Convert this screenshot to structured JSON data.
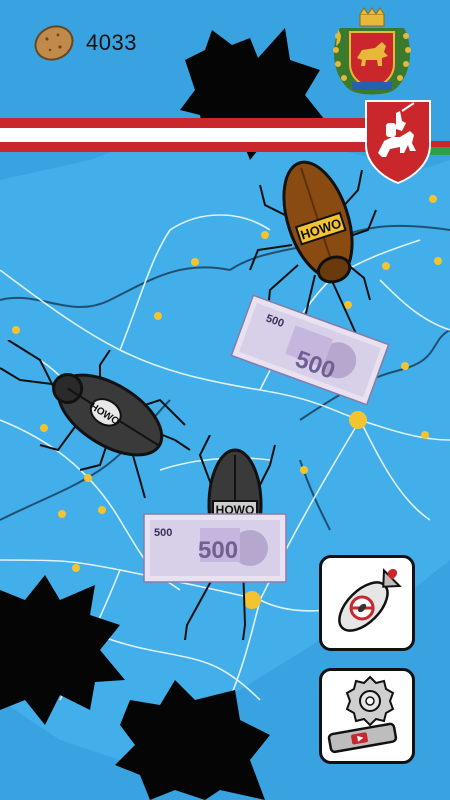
{
  "hud": {
    "score": "4033",
    "coin_icon": "potato-coin-icon"
  },
  "banknote": {
    "denomination": "500"
  },
  "cockroaches": [
    {
      "label": "HOWO",
      "color": "#8a4b12"
    },
    {
      "label": "HOWO",
      "color": "#2a2a2a"
    },
    {
      "label": "HOWO",
      "color": "#2a2a2a"
    }
  ],
  "abilities": [
    {
      "name": "bomb-ability",
      "icon": "bomb-icon"
    },
    {
      "name": "saw-ability",
      "icon": "circular-saw-icon"
    }
  ],
  "colors": {
    "map_blue": "#39a3e1",
    "road_white": "#e9f6ff",
    "city_yellow": "#f4c430",
    "flag_red": "#c9272b",
    "flag_green": "#2f9e44"
  }
}
